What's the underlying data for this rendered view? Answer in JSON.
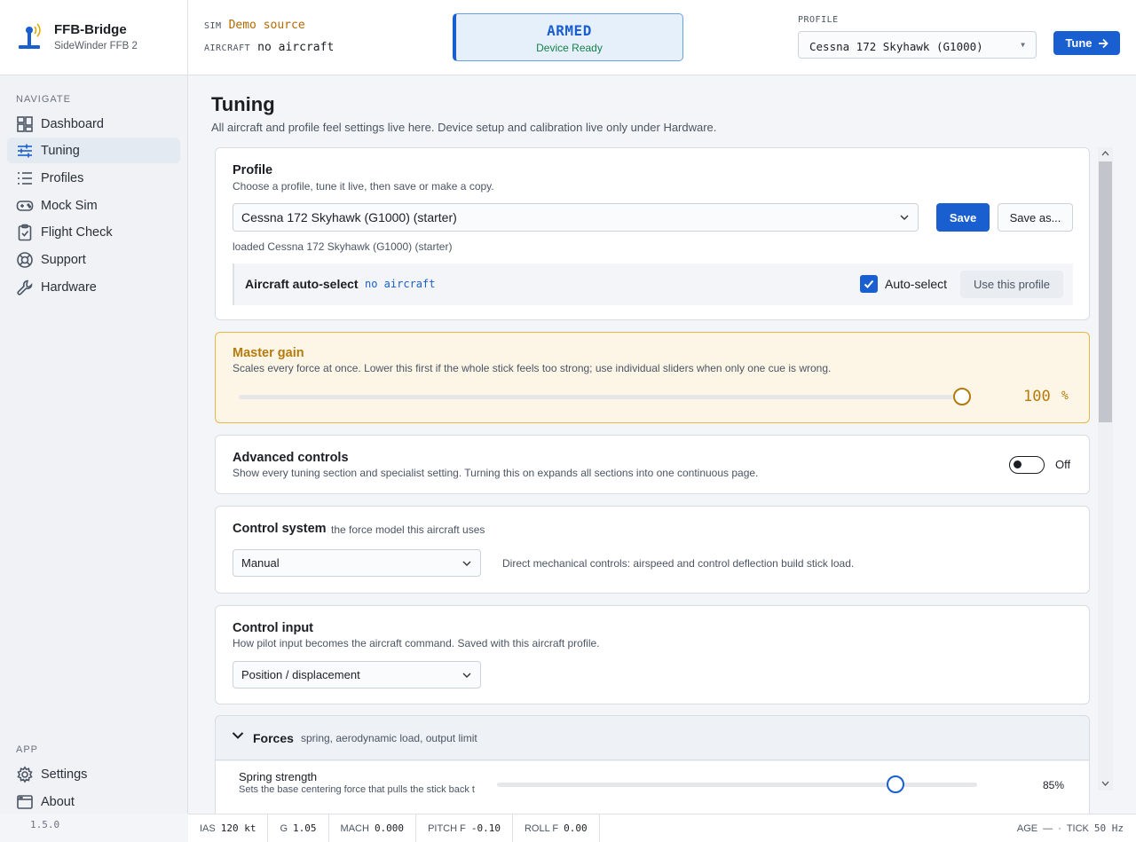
{
  "brand": {
    "name": "FFB-Bridge",
    "subtitle": "SideWinder FFB 2"
  },
  "nav": {
    "heading": "NAVIGATE",
    "items": [
      {
        "label": "Dashboard",
        "icon": "dashboard-grid-icon"
      },
      {
        "label": "Tuning",
        "icon": "sliders-icon",
        "active": true
      },
      {
        "label": "Profiles",
        "icon": "list-icon"
      },
      {
        "label": "Mock Sim",
        "icon": "gamepad-icon"
      },
      {
        "label": "Flight Check",
        "icon": "clipboard-check-icon"
      },
      {
        "label": "Support",
        "icon": "lifebuoy-icon"
      },
      {
        "label": "Hardware",
        "icon": "wrench-icon"
      }
    ],
    "app_heading": "APP",
    "app_items": [
      {
        "label": "Settings",
        "icon": "gear-icon"
      },
      {
        "label": "About",
        "icon": "window-icon"
      }
    ],
    "version": "1.5.0"
  },
  "header": {
    "sim_label": "SIM",
    "sim_value": "Demo source",
    "aircraft_label": "AIRCRAFT",
    "aircraft_value": "no aircraft",
    "status_title": "ARMED",
    "status_sub": "Device Ready",
    "profile_label": "PROFILE",
    "profile_value": "Cessna 172 Skyhawk (G1000)",
    "tune_label": "Tune"
  },
  "page": {
    "title": "Tuning",
    "description": "All aircraft and profile feel settings live here. Device setup and calibration live only under Hardware."
  },
  "profile_card": {
    "title": "Profile",
    "description": "Choose a profile, tune it live, then save or make a copy.",
    "selected": "Cessna 172 Skyhawk (G1000) (starter)",
    "save_label": "Save",
    "save_as_label": "Save as...",
    "loaded_text": "loaded Cessna 172 Skyhawk (G1000) (starter)",
    "autoselect_title": "Aircraft auto-select",
    "autoselect_value": "no aircraft",
    "autoselect_checkbox_label": "Auto-select",
    "autoselect_checked": true,
    "use_profile_label": "Use this profile"
  },
  "master_gain": {
    "title": "Master gain",
    "description": "Scales every force at once. Lower this first if the whole stick feels too strong; use individual sliders when only one cue is wrong.",
    "value": "100",
    "unit": "%",
    "fraction": 1.0
  },
  "advanced": {
    "title": "Advanced controls",
    "description": "Show every tuning section and specialist setting. Turning this on expands all sections into one continuous page.",
    "state_label": "Off",
    "on": false
  },
  "control_system": {
    "title": "Control system",
    "subtitle": "the force model this aircraft uses",
    "selected": "Manual",
    "note": "Direct mechanical controls: airspeed and control deflection build stick load."
  },
  "control_input": {
    "title": "Control input",
    "description": "How pilot input becomes the aircraft command. Saved with this aircraft profile.",
    "selected": "Position / displacement"
  },
  "forces": {
    "title": "Forces",
    "subtitle": "spring, aerodynamic load, output limit",
    "spring_label": "Spring strength",
    "spring_desc": "Sets the base centering force that pulls the stick back t",
    "spring_value": "85%",
    "spring_fraction": 0.83
  },
  "footer": {
    "ias_label": "IAS",
    "ias_value": "120 kt",
    "g_label": "G",
    "g_value": "1.05",
    "mach_label": "MACH",
    "mach_value": "0.000",
    "pitch_label": "PITCH F",
    "pitch_value": "-0.10",
    "roll_label": "ROLL F",
    "roll_value": "0.00",
    "age_label": "AGE",
    "age_value": "—",
    "sep": "·",
    "tick_label": "TICK",
    "tick_value": "50 Hz"
  },
  "colors": {
    "accent": "#1a5fd0",
    "gain_amber": "#b57a0c",
    "gain_bg": "#fdf6e7",
    "sim_orange": "#b26a00",
    "ready_green": "#16804a"
  }
}
